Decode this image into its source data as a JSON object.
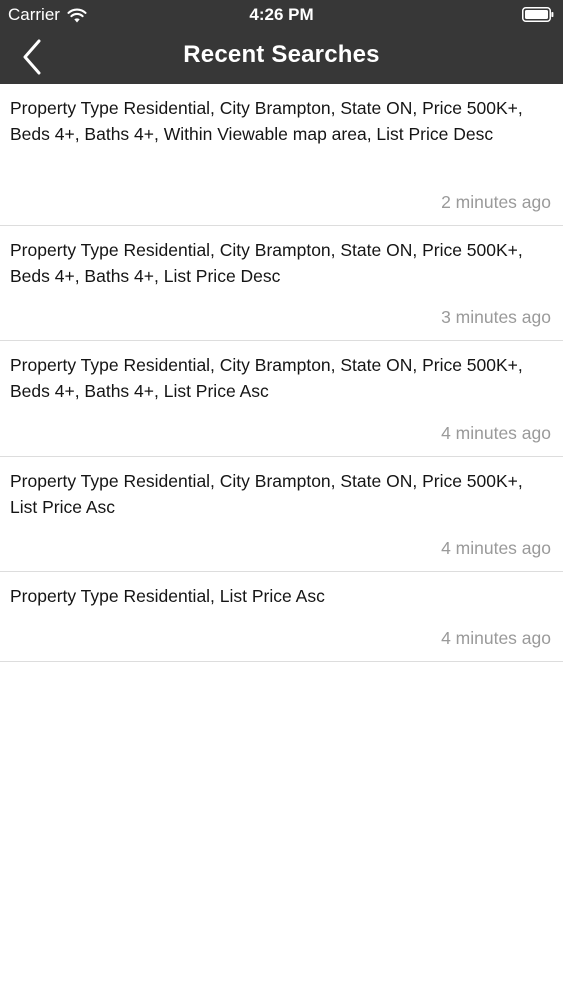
{
  "status_bar": {
    "carrier": "Carrier",
    "time": "4:26 PM"
  },
  "nav": {
    "title": "Recent Searches",
    "back_icon": "chevron-left-icon"
  },
  "searches": [
    {
      "text": "Property Type Residential, City Brampton, State ON, Price 500K+, Beds 4+, Baths 4+, Within Viewable map area, List Price Desc",
      "time": "2 minutes ago"
    },
    {
      "text": "Property Type Residential, City Brampton, State ON, Price 500K+, Beds 4+, Baths 4+, List Price Desc",
      "time": "3 minutes ago"
    },
    {
      "text": "Property Type Residential, City Brampton, State ON, Price 500K+, Beds 4+, Baths 4+, List Price Asc",
      "time": "4 minutes ago"
    },
    {
      "text": "Property Type Residential, City Brampton, State ON, Price 500K+, List Price Asc",
      "time": "4 minutes ago"
    },
    {
      "text": "Property Type Residential, List Price Asc",
      "time": "4 minutes ago"
    }
  ],
  "colors": {
    "header_background": "#373737",
    "header_text": "#ffffff",
    "timestamp_text": "#9a9a9a",
    "divider": "#dddddd"
  }
}
